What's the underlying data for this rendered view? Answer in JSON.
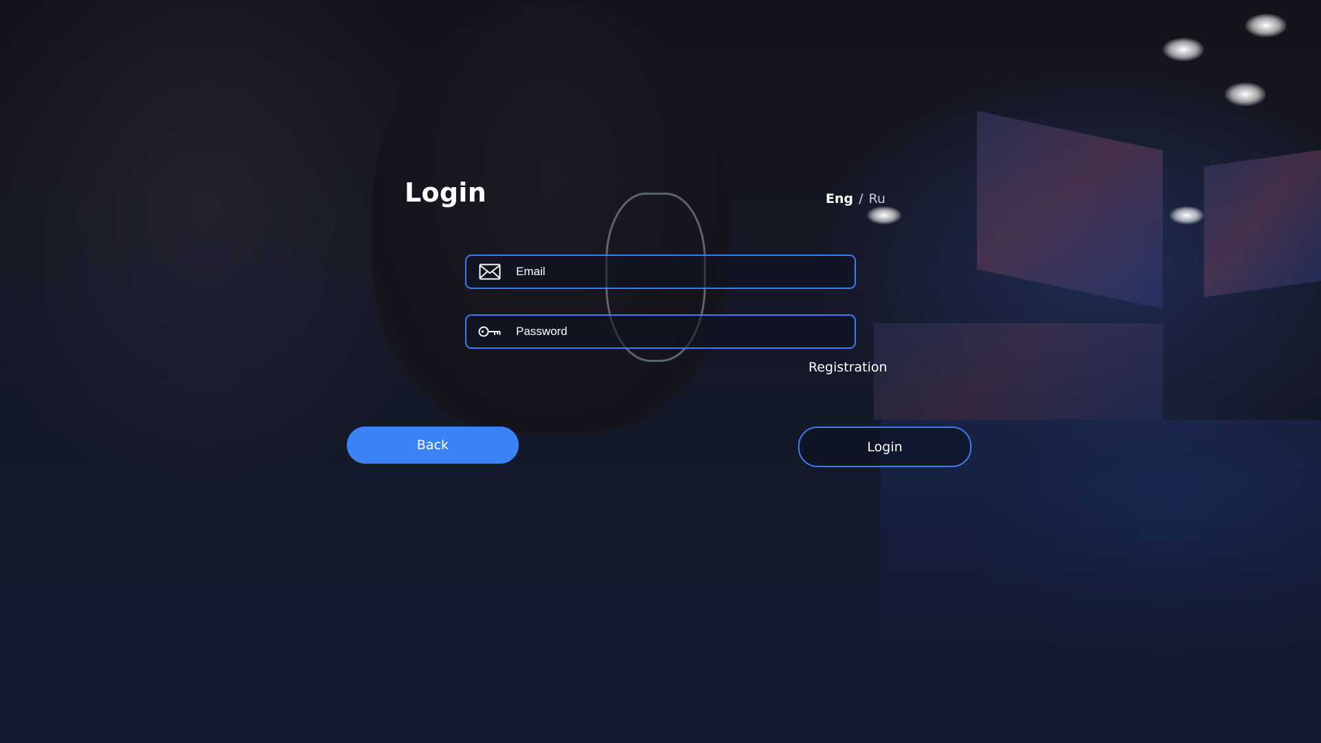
{
  "page": {
    "title": "Login"
  },
  "language": {
    "active": "Eng",
    "separator": "/",
    "inactive": "Ru"
  },
  "form": {
    "email": {
      "placeholder": "Email",
      "value": "",
      "icon": "envelope-icon"
    },
    "password": {
      "placeholder": "Password",
      "value": "",
      "icon": "key-icon"
    },
    "registration_link": "Registration"
  },
  "buttons": {
    "back": "Back",
    "login": "Login"
  },
  "colors": {
    "accent": "#3b82f6",
    "border": "#3d7df0",
    "background": "#121b30",
    "text": "#ffffff"
  }
}
